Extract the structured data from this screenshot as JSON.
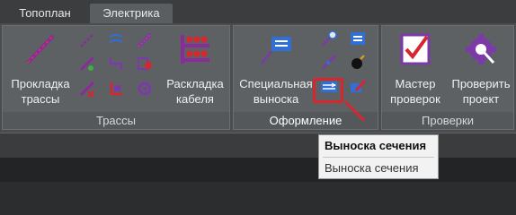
{
  "tabs": [
    {
      "label": "Топоплан",
      "active": false
    },
    {
      "label": "Электрика",
      "active": true
    }
  ],
  "panels": {
    "traces": {
      "title": "Трассы",
      "big_buttons": [
        {
          "line1": "Прокладка",
          "line2": "трассы",
          "icon": "route-line-icon"
        },
        {
          "line1": "Раскладка",
          "line2": "кабеля",
          "icon": "cable-layout-icon"
        }
      ],
      "small_icons": [
        "trace-tool-1-icon",
        "trace-tool-2-icon",
        "trace-tool-3-icon",
        "trace-tool-4-icon",
        "trace-tool-5-icon",
        "trace-tool-6-icon",
        "trace-tool-7-icon",
        "trace-tool-8-icon",
        "trace-tool-9-icon"
      ]
    },
    "design": {
      "title": "Оформление",
      "big_buttons": [
        {
          "line1": "Специальная",
          "line2": "выноска",
          "icon": "special-callout-icon"
        }
      ],
      "small_icons": [
        "design-tool-1-icon",
        "design-tool-2-icon",
        "design-tool-3-icon",
        "design-tool-4-icon",
        "section-callout-icon",
        "design-tool-6-icon"
      ]
    },
    "checks": {
      "title": "Проверки",
      "big_buttons": [
        {
          "line1": "Мастер",
          "line2": "проверок",
          "icon": "check-master-icon"
        },
        {
          "line1": "Проверить",
          "line2": "проект",
          "icon": "check-project-gear-icon"
        }
      ]
    }
  },
  "tooltip": {
    "title": "Выноска сечения",
    "description": "Выноска сечения"
  },
  "colors": {
    "accent_red": "#d8262f",
    "icon_purple": "#7b3aa8",
    "icon_blue": "#2f6fd6"
  }
}
